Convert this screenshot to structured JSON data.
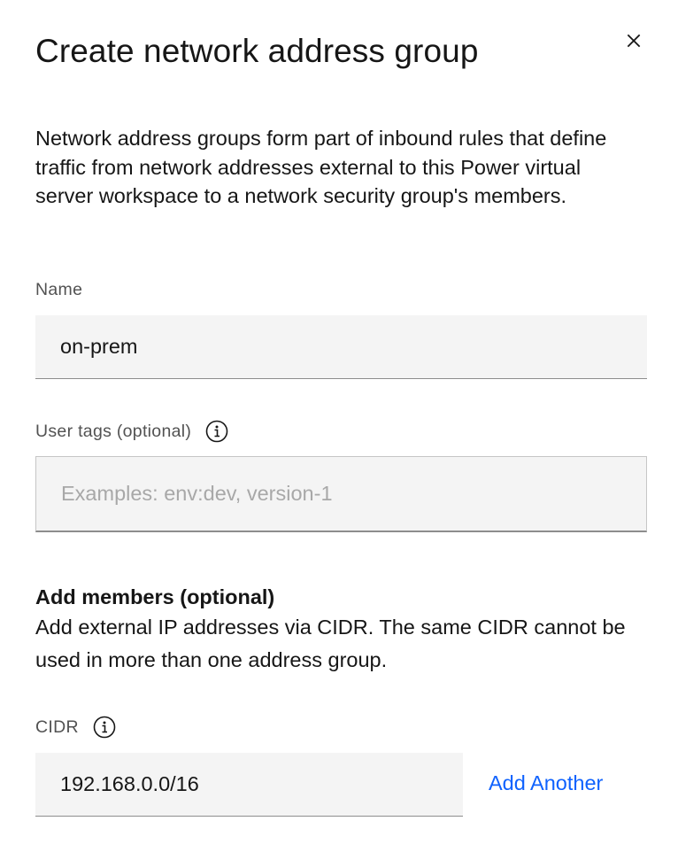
{
  "modal": {
    "title": "Create network address group",
    "description": "Network address groups form part of inbound rules that define traffic from network addresses external to this Power virtual server workspace to a network security group's members."
  },
  "name_field": {
    "label": "Name",
    "value": "on-prem"
  },
  "tags_field": {
    "label": "User tags (optional)",
    "placeholder": "Examples: env:dev, version-1"
  },
  "members": {
    "heading": "Add members (optional)",
    "description": "Add external IP addresses via CIDR. The same CIDR cannot be used in more than one address group."
  },
  "cidr_field": {
    "label": "CIDR",
    "value": "192.168.0.0/16",
    "add_link": "Add Another"
  },
  "colors": {
    "link": "#0f62fe",
    "field_bg": "#f4f4f4",
    "label": "#525252",
    "text": "#161616"
  },
  "icons": {
    "close": "close-icon",
    "info": "information-icon"
  }
}
